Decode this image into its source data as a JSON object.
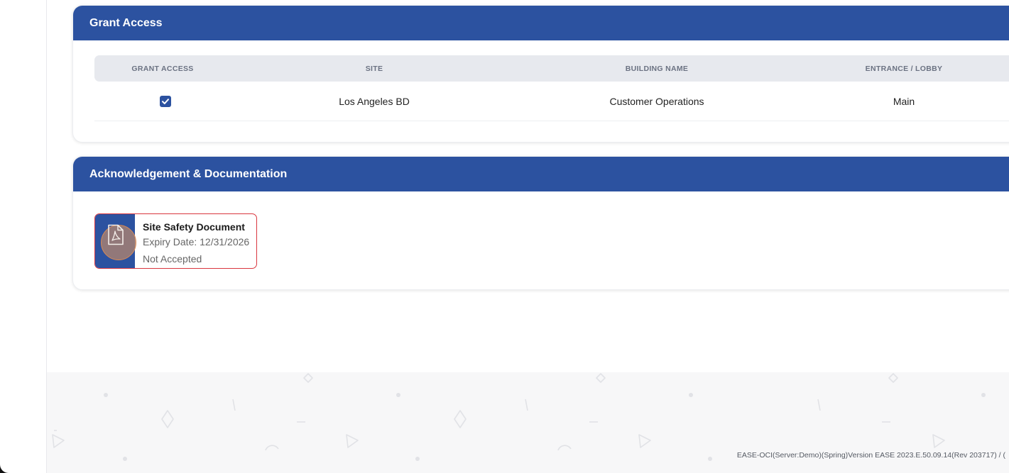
{
  "grant_access": {
    "title": "Grant Access",
    "columns": [
      "GRANT ACCESS",
      "SITE",
      "BUILDING NAME",
      "ENTRANCE / LOBBY"
    ],
    "rows": [
      {
        "granted": true,
        "site": "Los Angeles BD",
        "building": "Customer Operations",
        "entrance": "Main"
      }
    ]
  },
  "acknowledgement": {
    "title": "Acknowledgement & Documentation",
    "documents": [
      {
        "name": "Site Safety Document",
        "expiry": "Expiry Date: 12/31/2026",
        "status": "Not Accepted",
        "icon": "pdf-icon"
      }
    ]
  },
  "footer": {
    "version": "EASE-OCI(Server:Demo)(Spring)Version EASE 2023.E.50.09.14(Rev 203717)  /  ("
  },
  "colors": {
    "primary": "#2c52a0",
    "alert_border": "#d9363e"
  }
}
